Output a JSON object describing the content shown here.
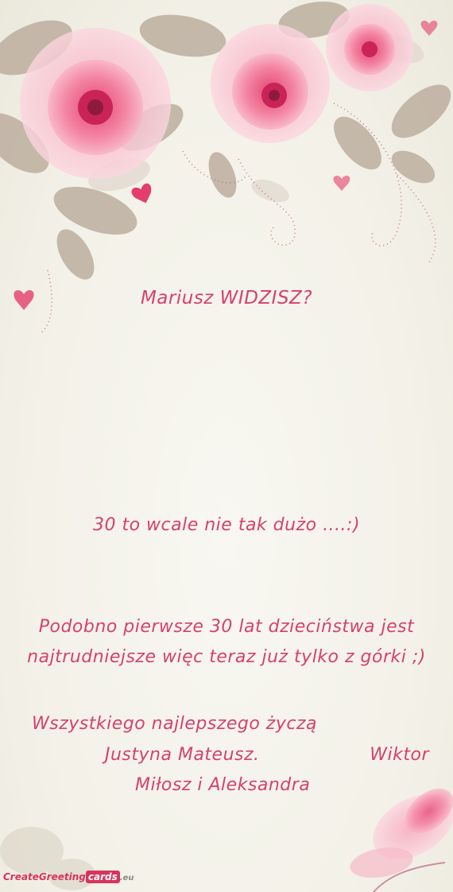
{
  "card": {
    "title": "Mariusz WIDZISZ?",
    "subtitle": "30 to wcale nie tak dużo ....:)",
    "body": "Podobno pierwsze 30 lat dzieciństwa jest najtrudniejsze więc teraz już tylko z górki ;)",
    "wishes": "Wszystkiego najlepszego życzą",
    "names_part1": "Justyna Mateusz.",
    "names_part2": "Wiktor",
    "names_line2": "Miłosz i Aleksandra"
  },
  "watermark": {
    "brand": "CreateGreeting",
    "brand_highlight": "cards",
    "suffix": ".eu"
  },
  "colors": {
    "text": "#d6416e",
    "flower_pink": "#f06a8f",
    "leaf_beige": "#b8a89a",
    "background": "#f3f1e9"
  }
}
